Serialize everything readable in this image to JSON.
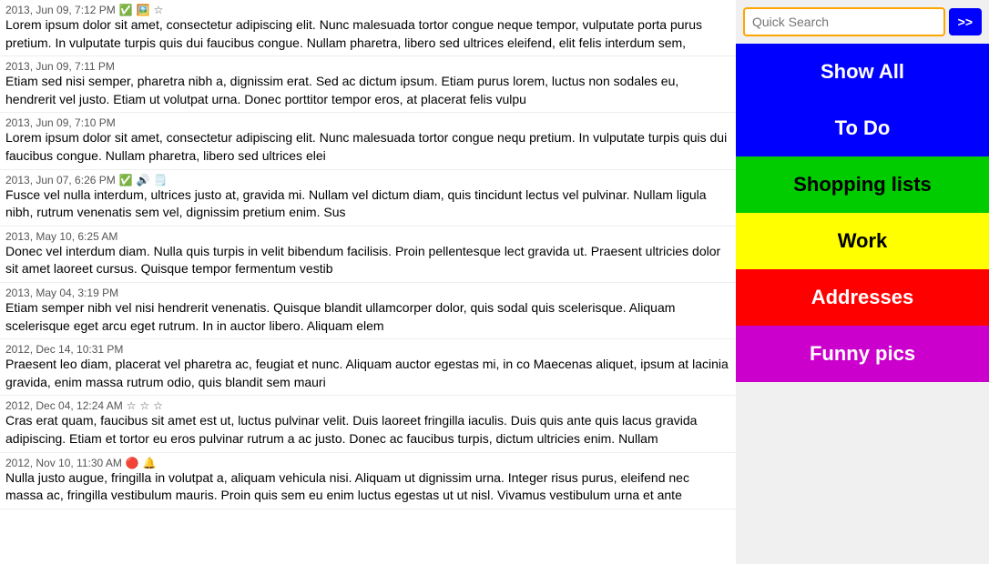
{
  "search": {
    "placeholder": "Quick Search",
    "search_btn_label": ">>"
  },
  "categories": [
    {
      "id": "show-all",
      "label": "Show All",
      "class": "btn-show-all"
    },
    {
      "id": "todo",
      "label": "To Do",
      "class": "btn-todo"
    },
    {
      "id": "shopping",
      "label": "Shopping lists",
      "class": "btn-shopping"
    },
    {
      "id": "work",
      "label": "Work",
      "class": "btn-work"
    },
    {
      "id": "addresses",
      "label": "Addresses",
      "class": "btn-addresses"
    },
    {
      "id": "funny",
      "label": "Funny pics",
      "class": "btn-funny"
    }
  ],
  "list_items": [
    {
      "date": "2013, Jun 09, 7:12 PM",
      "icons": [
        "✅",
        "🖼️",
        "☆"
      ],
      "text": "Lorem ipsum dolor sit amet, consectetur adipiscing elit. Nunc malesuada tortor congue neque tempor, vulputate porta purus pretium. In vulputate turpis quis dui faucibus congue. Nullam pharetra, libero sed ultrices eleifend, elit felis interdum sem,"
    },
    {
      "date": "2013, Jun 09, 7:11 PM",
      "icons": [],
      "text": "Etiam sed nisi semper, pharetra nibh a, dignissim erat. Sed ac dictum ipsum. Etiam purus lorem, luctus non sodales eu, hendrerit vel justo. Etiam ut volutpat urna. Donec porttitor tempor eros, at placerat felis vulpu"
    },
    {
      "date": "2013, Jun 09, 7:10 PM",
      "icons": [],
      "text": "Lorem ipsum dolor sit amet, consectetur adipiscing elit. Nunc malesuada tortor congue nequ pretium. In vulputate turpis quis dui faucibus congue. Nullam pharetra, libero sed ultrices elei"
    },
    {
      "date": "2013, Jun 07, 6:26 PM",
      "icons": [
        "✅",
        "🔊",
        "🗒️"
      ],
      "text": "Fusce vel nulla interdum, ultrices justo at, gravida mi. Nullam vel dictum diam, quis tincidunt lectus vel pulvinar. Nullam ligula nibh, rutrum venenatis sem vel, dignissim pretium enim. Sus"
    },
    {
      "date": "2013, May 10, 6:25 AM",
      "icons": [],
      "text": "Donec vel interdum diam. Nulla quis turpis in velit bibendum facilisis. Proin pellentesque lect gravida ut. Praesent ultricies dolor sit amet laoreet cursus. Quisque tempor fermentum vestib"
    },
    {
      "date": "2013, May 04, 3:19 PM",
      "icons": [],
      "text": "Etiam semper nibh vel nisi hendrerit venenatis. Quisque blandit ullamcorper dolor, quis sodal quis scelerisque. Aliquam scelerisque eget arcu eget rutrum. In in auctor libero. Aliquam elem"
    },
    {
      "date": "2012, Dec 14, 10:31 PM",
      "icons": [],
      "text": "Praesent leo diam, placerat vel pharetra ac, feugiat et nunc. Aliquam auctor egestas mi, in co Maecenas aliquet, ipsum at lacinia gravida, enim massa rutrum odio, quis blandit sem mauri"
    },
    {
      "date": "2012, Dec 04, 12:24 AM",
      "icons": [
        "☆",
        "☆",
        "☆"
      ],
      "text": "Cras erat quam, faucibus sit amet est ut, luctus pulvinar velit. Duis laoreet fringilla iaculis. Duis quis ante quis lacus gravida adipiscing. Etiam et tortor eu eros pulvinar rutrum a ac justo. Donec ac faucibus turpis, dictum ultricies enim. Nullam"
    },
    {
      "date": "2012, Nov 10, 11:30 AM",
      "icons": [
        "🔴",
        "🔔"
      ],
      "text": "Nulla justo augue, fringilla in volutpat a, aliquam vehicula nisi. Aliquam ut dignissim urna. Integer risus purus, eleifend nec massa ac, fringilla vestibulum mauris. Proin quis sem eu enim luctus egestas ut ut nisl. Vivamus vestibulum urna et ante"
    }
  ]
}
